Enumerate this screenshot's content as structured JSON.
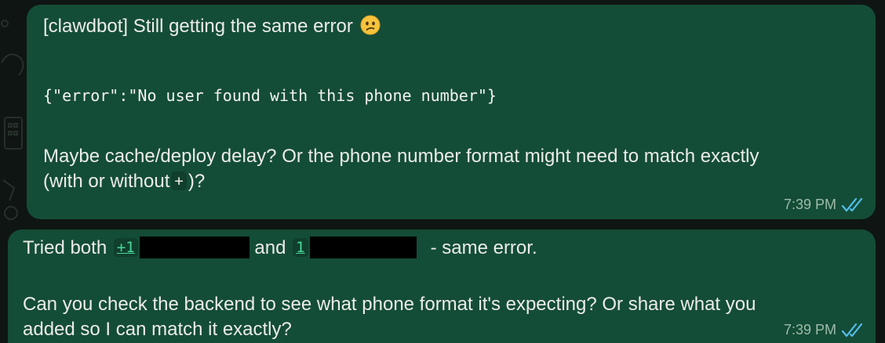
{
  "chat": {
    "messages": [
      {
        "first_line": "[clawdbot] Still getting the same error",
        "emoji": "confused-face",
        "code": "{\"error\":\"No user found with this phone number\"}",
        "para_line1": "Maybe cache/deploy delay? Or the phone number format might need to match exactly",
        "para_line2_a": "(with or without",
        "para_line2_code": "+",
        "para_line2_b": ")?",
        "time": "7:39 PM",
        "status": "read"
      },
      {
        "lead": "Tried both",
        "code1": "+1",
        "mid": "and",
        "code2": "1",
        "tail": "- same error.",
        "para_line1": "Can you check the backend to see what phone format it's expecting? Or share what you",
        "para_line2": "added so I can match it exactly?",
        "time": "7:39 PM",
        "status": "read"
      }
    ]
  },
  "colors": {
    "bubble": "#144d37",
    "background": "#0f1512",
    "read_check": "#53bdeb",
    "link": "#4ad69a"
  }
}
